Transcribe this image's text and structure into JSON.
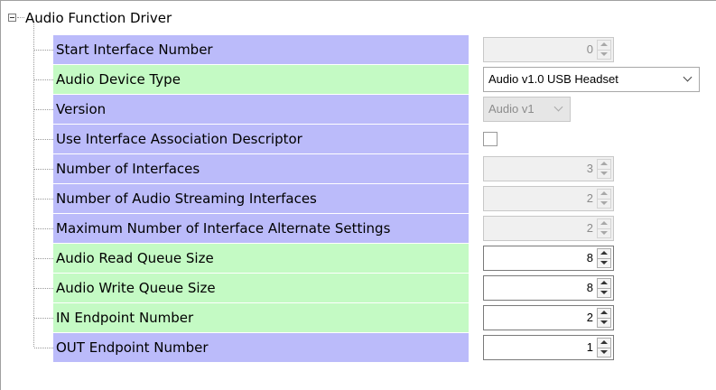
{
  "root": {
    "label": "Audio Function Driver"
  },
  "rows": [
    {
      "label": "Start Interface Number",
      "control": "spin",
      "value": "0",
      "enabled": false,
      "bg": "purple"
    },
    {
      "label": "Audio Device Type",
      "control": "combo",
      "value": "Audio v1.0 USB Headset",
      "enabled": true,
      "bg": "green"
    },
    {
      "label": "Version",
      "control": "combo",
      "value": "Audio v1",
      "enabled": false,
      "bg": "purple"
    },
    {
      "label": "Use Interface Association Descriptor",
      "control": "checkbox",
      "checked": false,
      "bg": "purple"
    },
    {
      "label": "Number of Interfaces",
      "control": "spin",
      "value": "3",
      "enabled": false,
      "bg": "purple"
    },
    {
      "label": "Number of Audio Streaming Interfaces",
      "control": "spin",
      "value": "2",
      "enabled": false,
      "bg": "purple"
    },
    {
      "label": "Maximum Number of Interface Alternate Settings",
      "control": "spin",
      "value": "2",
      "enabled": false,
      "bg": "purple"
    },
    {
      "label": "Audio Read Queue Size",
      "control": "spin",
      "value": "8",
      "enabled": true,
      "bg": "green"
    },
    {
      "label": "Audio Write Queue Size",
      "control": "spin",
      "value": "8",
      "enabled": true,
      "bg": "green"
    },
    {
      "label": "IN Endpoint Number",
      "control": "spin",
      "value": "2",
      "enabled": true,
      "bg": "green"
    },
    {
      "label": "OUT Endpoint Number",
      "control": "spin",
      "value": "1",
      "enabled": true,
      "bg": "purple"
    }
  ],
  "colors": {
    "purple": "#bbbbfa",
    "green": "#c4fac4"
  },
  "icons": {
    "root_toggle": "tree-collapse-icon",
    "spin": "spinner-arrows-icon",
    "combo": "chevron-down-icon"
  }
}
